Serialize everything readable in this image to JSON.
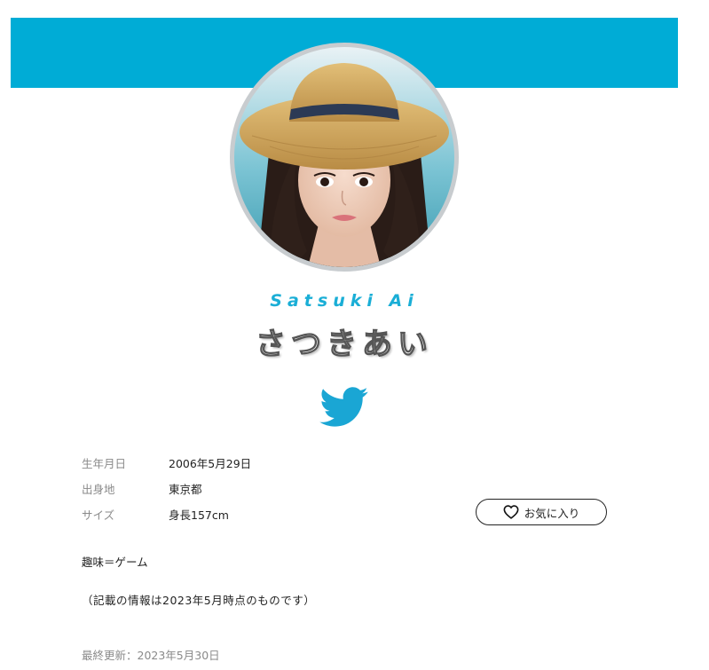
{
  "colors": {
    "banner": "#00acd6",
    "accent": "#1aaed6",
    "twitter": "#1aa6d4"
  },
  "profile": {
    "photo_description": "portrait photo of a young woman in a straw hat",
    "name_romaji": "Satsuki Ai",
    "name_kana": "さつきあい"
  },
  "social": {
    "icon": "twitter-bird-icon"
  },
  "details": [
    {
      "label": "生年月日",
      "value": "2006年5月29日"
    },
    {
      "label": "出身地",
      "value": "東京都"
    },
    {
      "label": "サイズ",
      "value": "身長157cm"
    }
  ],
  "favorite_button": {
    "icon": "heart-outline-icon",
    "label": "お気に入り"
  },
  "hobby": "趣味＝ゲーム",
  "note": "（記載の情報は2023年5月時点のものです）",
  "last_updated": "最終更新：2023年5月30日"
}
